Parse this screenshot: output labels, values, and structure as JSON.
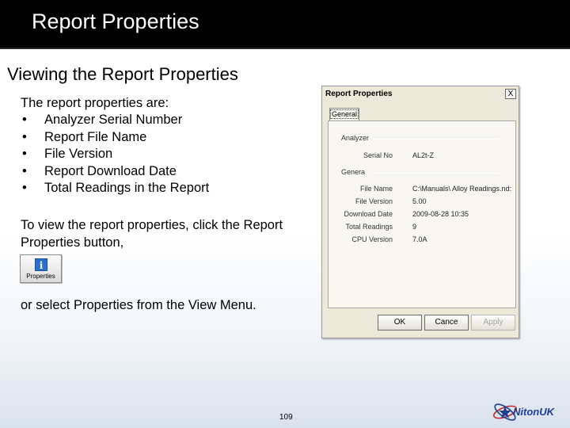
{
  "slide": {
    "title": "Report Properties",
    "subtitle": "Viewing the Report Properties",
    "intro": "The report properties are:",
    "bullet_char": "•",
    "bullets": [
      "Analyzer Serial Number",
      "Report File Name",
      "File Version",
      "Report Download Date",
      "Total Readings in the Report"
    ],
    "click_instruction": "To view the report properties, click the Report Properties button,",
    "view_menu_instruction": "or select Properties from the View Menu.",
    "properties_button_label": "Properties",
    "page_number": "109",
    "logo_text": "NitonUK"
  },
  "dialog": {
    "title": "Report Properties",
    "close_glyph": "X",
    "tab_label": "General",
    "analyzer_group": "Analyzer",
    "general_group": "Genera",
    "serial_label": "Serial No",
    "serial_value": "AL2t-Z",
    "rows": [
      {
        "label": "File Name",
        "value": "C:\\Manuals\\ Alloy Readings.nd:"
      },
      {
        "label": "File Version",
        "value": "5.00"
      },
      {
        "label": "Download Date",
        "value": "2009-08-28 10:35"
      },
      {
        "label": "Total Readings",
        "value": "9"
      },
      {
        "label": "CPU Version",
        "value": "7.0A"
      }
    ],
    "ok_label": "OK",
    "cancel_label": "Cance",
    "apply_label": "Apply"
  },
  "colors": {
    "title_bar": "#000000",
    "title_text": "#ffffff",
    "dialog_bg": "#ece9d8",
    "logo_blue": "#1d3d8f",
    "logo_red": "#c0282d"
  }
}
